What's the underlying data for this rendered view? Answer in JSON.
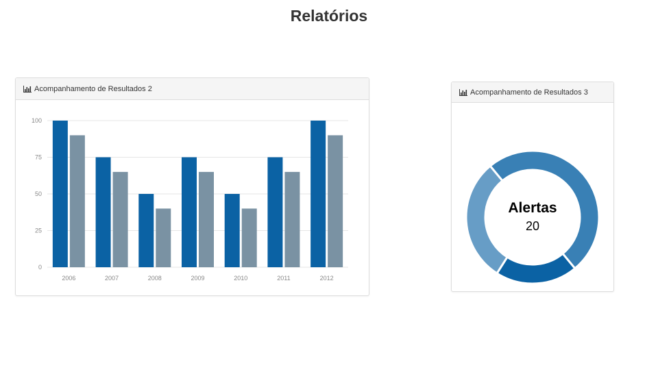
{
  "page": {
    "title": "Relatórios"
  },
  "panels": {
    "bar": {
      "title": "Acompanhamento de Resultados 2"
    },
    "donut": {
      "title": "Acompanhamento de Resultados 3"
    }
  },
  "chart_data": [
    {
      "type": "bar",
      "categories": [
        "2006",
        "2007",
        "2008",
        "2009",
        "2010",
        "2011",
        "2012"
      ],
      "series": [
        {
          "values": [
            100,
            75,
            50,
            75,
            50,
            75,
            100
          ],
          "color": "#0b62a4"
        },
        {
          "values": [
            90,
            65,
            40,
            65,
            40,
            65,
            90
          ],
          "color": "#7a92a3"
        }
      ],
      "yticks": [
        0,
        25,
        50,
        75,
        100
      ],
      "ylim": [
        0,
        100
      ],
      "grid": true
    },
    {
      "type": "pie",
      "variant": "donut",
      "center_label": "Alertas",
      "center_value": "20",
      "slices": [
        {
          "value": 50,
          "color": "#3980b5"
        },
        {
          "value": 20,
          "color": "#0b62a4"
        },
        {
          "value": 30,
          "color": "#679dc6"
        }
      ]
    }
  ]
}
